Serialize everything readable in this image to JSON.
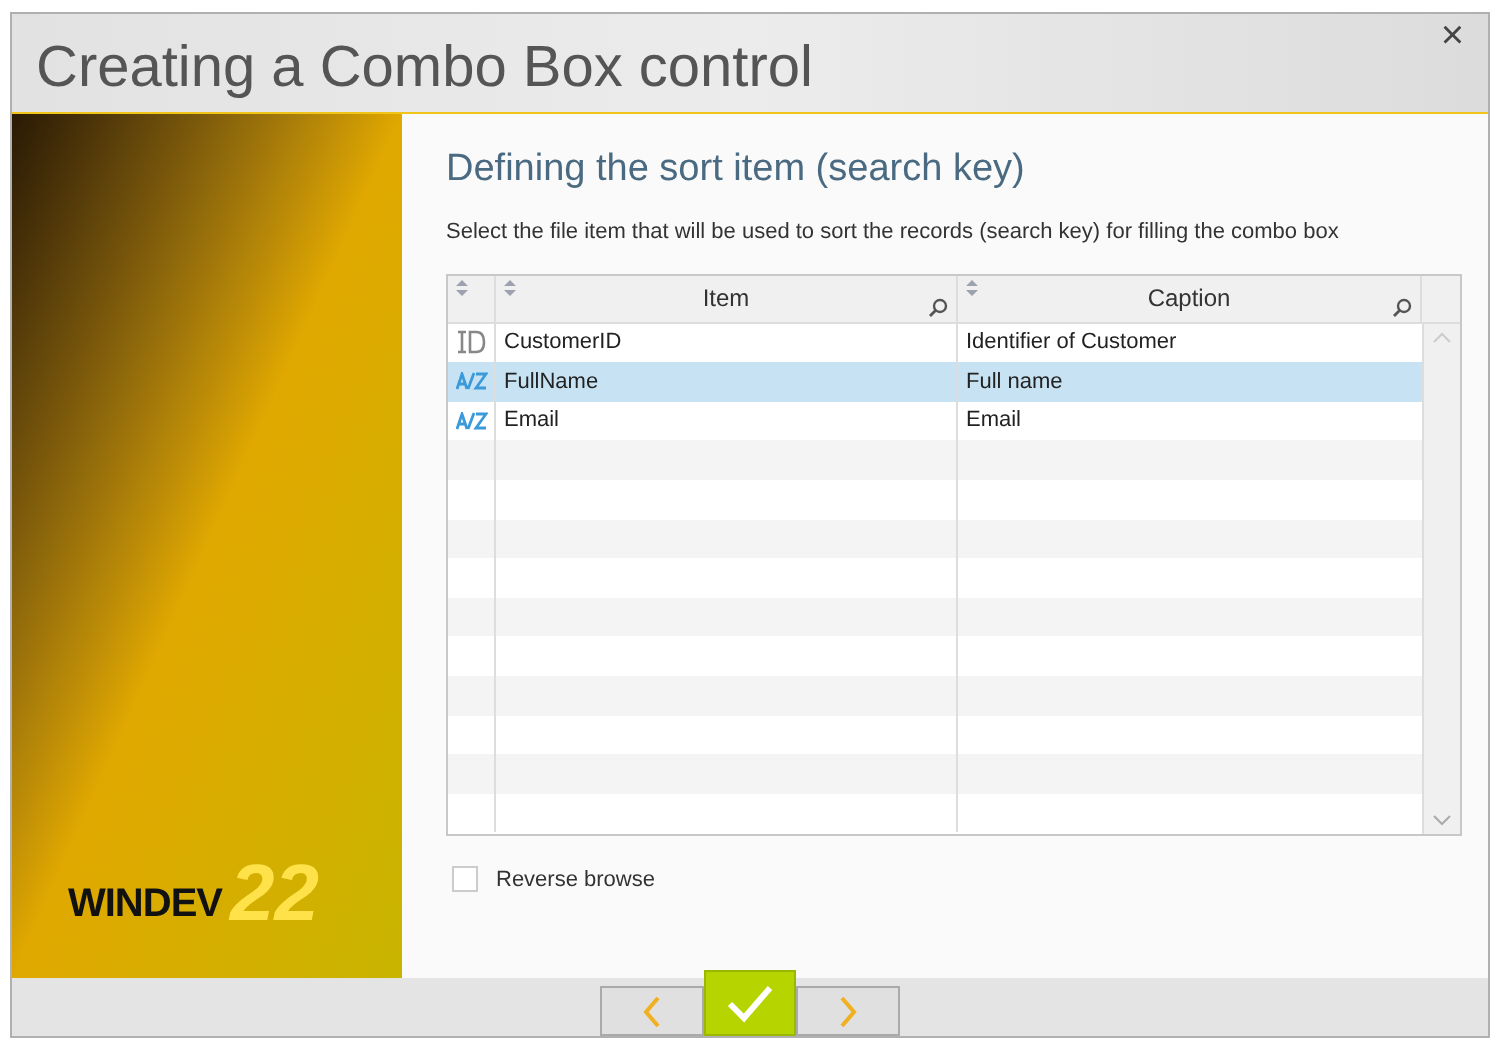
{
  "window": {
    "title": "Creating a Combo Box control",
    "close": "×"
  },
  "logo": {
    "name": "WINDEV",
    "version": "22"
  },
  "heading": "Defining the sort item (search key)",
  "description": "Select the file item that will be used to sort the records (search key) for filling the combo box",
  "table": {
    "columns": [
      "Item",
      "Caption"
    ],
    "rows": [
      {
        "kind": "id",
        "item": "CustomerID",
        "caption": "Identifier of Customer",
        "selected": false
      },
      {
        "kind": "az",
        "item": "FullName",
        "caption": "Full name",
        "selected": true
      },
      {
        "kind": "az",
        "item": "Email",
        "caption": "Email",
        "selected": false
      }
    ]
  },
  "reverse_browse": {
    "label": "Reverse browse",
    "checked": false
  }
}
